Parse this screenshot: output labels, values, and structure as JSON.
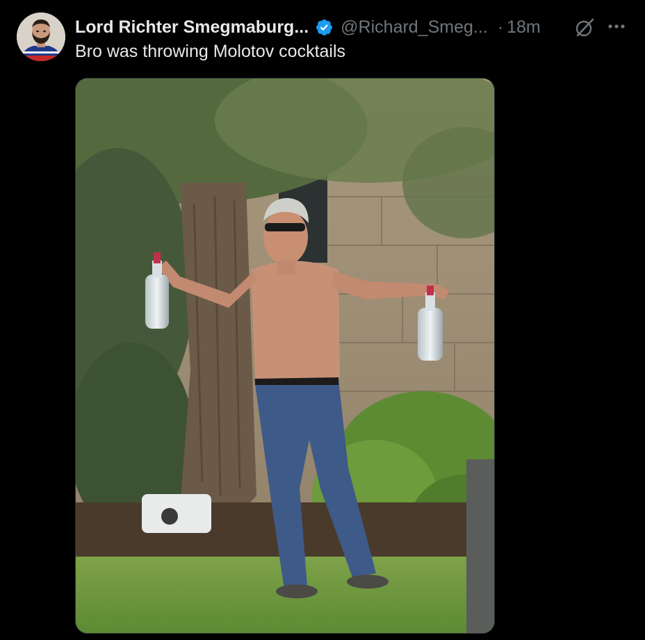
{
  "post": {
    "author": {
      "display_name": "Lord Richter Smegmaburg...",
      "handle": "@Richard_Smeg...",
      "verified": true,
      "avatar_icon": "avatar-portrait"
    },
    "separator": "·",
    "timestamp": "18m",
    "text": "Bro was throwing Molotov cocktails",
    "actions": {
      "grok_icon": "grok-icon",
      "more_icon": "more-icon"
    },
    "media": {
      "type": "photo",
      "scene": "shirtless man in jeans holding two glass bottles outdoors"
    }
  },
  "colors": {
    "background": "#000000",
    "primary_text": "#e7e9ea",
    "secondary_text": "#71767b",
    "verified_badge": "#1d9bf0",
    "border": "#2f3336"
  }
}
